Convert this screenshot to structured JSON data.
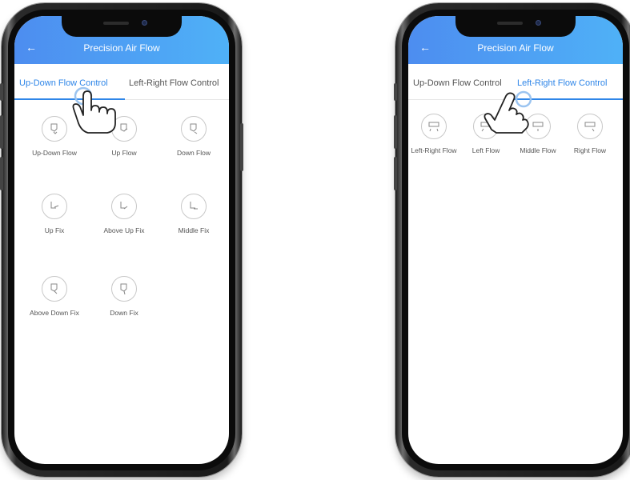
{
  "header": {
    "title": "Precision Air Flow",
    "back_icon": "arrow-left-icon"
  },
  "tabs": {
    "up_down": "Up-Down Flow Control",
    "left_right": "Left-Right Flow Control"
  },
  "up_down_items": [
    {
      "label": "Up-Down Flow",
      "icon": "up-down-flow-icon"
    },
    {
      "label": "Up Flow",
      "icon": "up-flow-icon"
    },
    {
      "label": "Down Flow",
      "icon": "down-flow-icon"
    },
    {
      "label": "Up Fix",
      "icon": "up-fix-icon"
    },
    {
      "label": "Above Up Fix",
      "icon": "above-up-fix-icon"
    },
    {
      "label": "Middle Fix",
      "icon": "middle-fix-icon"
    },
    {
      "label": "Above Down Fix",
      "icon": "above-down-fix-icon"
    },
    {
      "label": "Down Fix",
      "icon": "down-fix-icon"
    }
  ],
  "left_right_items": [
    {
      "label": "Left-Right Flow",
      "icon": "left-right-flow-icon"
    },
    {
      "label": "Left Flow",
      "icon": "left-flow-icon"
    },
    {
      "label": "Middle Flow",
      "icon": "middle-flow-icon"
    },
    {
      "label": "Right Flow",
      "icon": "right-flow-icon"
    }
  ],
  "colors": {
    "header_start": "#4d8df0",
    "header_end": "#4fb1f7",
    "active_tab": "#2f86e8"
  }
}
